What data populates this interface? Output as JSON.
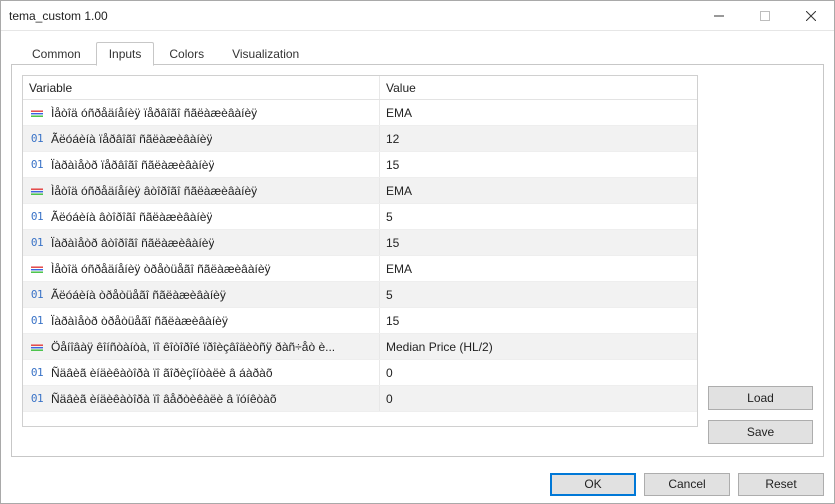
{
  "window": {
    "title": "tema_custom 1.00"
  },
  "tabs": {
    "common": "Common",
    "inputs": "Inputs",
    "colors": "Colors",
    "visualization": "Visualization",
    "active": "inputs"
  },
  "table": {
    "header_variable": "Variable",
    "header_value": "Value",
    "rows": [
      {
        "icon": "tri",
        "variable": "Ìåòîä óñðåäíåíèÿ ïåðâîãî ñãëàæèâàíèÿ",
        "value": "EMA"
      },
      {
        "icon": "num",
        "variable": "Ãëóáèíà  ïåðâîãî ñãëàæèâàíèÿ",
        "value": "12"
      },
      {
        "icon": "num",
        "variable": "Ïàðàìåòð ïåðâîãî ñãëàæèâàíèÿ",
        "value": "15"
      },
      {
        "icon": "tri",
        "variable": "Ìåòîä óñðåäíåíèÿ âòîðîãî ñãëàæèâàíèÿ",
        "value": "EMA"
      },
      {
        "icon": "num",
        "variable": "Ãëóáèíà  âòîðîãî ñãëàæèâàíèÿ",
        "value": "5"
      },
      {
        "icon": "num",
        "variable": "Ïàðàìåòð âòîðîãî ñãëàæèâàíèÿ",
        "value": "15"
      },
      {
        "icon": "tri",
        "variable": "Ìåòîä óñðåäíåíèÿ òðåòüåãî ñãëàæèâàíèÿ",
        "value": "EMA"
      },
      {
        "icon": "num",
        "variable": "Ãëóáèíà  òðåòüåãî ñãëàæèâàíèÿ",
        "value": "5"
      },
      {
        "icon": "num",
        "variable": "Ïàðàìåòð òðåòüåãî ñãëàæèâàíèÿ",
        "value": "15"
      },
      {
        "icon": "tri",
        "variable": "Öåíîâàÿ êîíñòàíòà, ïî êîòîðîé ïðîèçâîäèòñÿ ðàñ÷åò è...",
        "value": "Median Price (HL/2)"
      },
      {
        "icon": "num",
        "variable": "Ñäâèã èíäèêàòîðà ïî ãîðèçîíòàëè â áàðàõ",
        "value": "0"
      },
      {
        "icon": "num",
        "variable": "Ñäâèã èíäèêàòîðà ïî âåðòèêàëè â ïóíêòàõ",
        "value": "0"
      }
    ]
  },
  "buttons": {
    "load": "Load",
    "save": "Save",
    "ok": "OK",
    "cancel": "Cancel",
    "reset": "Reset"
  },
  "icons": {
    "num_glyph": "01"
  }
}
